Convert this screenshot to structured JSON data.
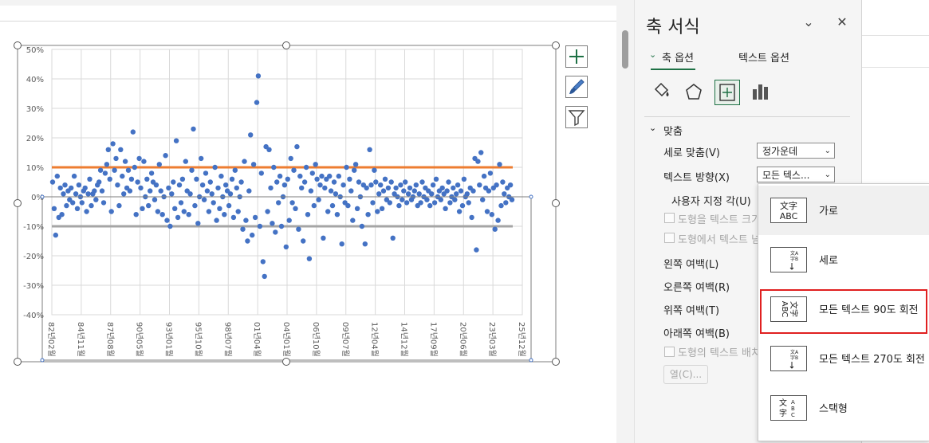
{
  "pane": {
    "title": "축 서식",
    "tab_axis_options": "축 옵션",
    "tab_text_options": "텍스트 옵션",
    "section_title": "맞춤",
    "vertical_align_label": "세로 맞춤(V)",
    "vertical_align_value": "정가운데",
    "text_direction_label": "텍스트 방향(X)",
    "text_direction_value": "모든 텍스...",
    "custom_angle_label": "사용자 지정 각(U)",
    "resize_shape_label": "도형을 텍스트 크기",
    "wrap_text_label": "도형에서 텍스트 넘",
    "left_margin_label": "왼쪽 여백(L)",
    "right_margin_label": "오른쪽 여백(R)",
    "top_margin_label": "위쪽 여백(T)",
    "bottom_margin_label": "아래쪽 여백(B)",
    "rotate_text_label": "도형의 텍스트 배치",
    "columns_button": "열(C)..."
  },
  "dropdown": {
    "options": [
      {
        "label": "가로",
        "icon": "horizontal-text-icon"
      },
      {
        "label": "세로",
        "icon": "vertical-text-icon"
      },
      {
        "label": "모든 텍스트 90도 회전",
        "icon": "rotate90-text-icon"
      },
      {
        "label": "모든 텍스트 270도 회전",
        "icon": "rotate270-text-icon"
      },
      {
        "label": "스택형",
        "icon": "stacked-text-icon"
      }
    ],
    "selected_index": 2
  },
  "chart_data": {
    "type": "scatter",
    "title": "",
    "xlabel": "",
    "ylabel": "",
    "ylim": [
      -0.4,
      0.5
    ],
    "y_ticks": [
      "50%",
      "40%",
      "30%",
      "20%",
      "10%",
      "0%",
      "-10%",
      "-20%",
      "-30%",
      "-40%"
    ],
    "x_ticks": [
      "82년02월",
      "84년11월",
      "87년08월",
      "90년05월",
      "93년01월",
      "95년10월",
      "98년07월",
      "01년04월",
      "04년01월",
      "06년10월",
      "09년07월",
      "12년04월",
      "14년12월",
      "17년09월",
      "20년06월",
      "23년03월",
      "25년12월"
    ],
    "lines": [
      {
        "value": 0.1,
        "color": "#ed7d31"
      },
      {
        "value": -0.1,
        "color": "#a5a5a5"
      }
    ],
    "series": [
      {
        "color": "#4472c4",
        "values": [
          0.05,
          -0.04,
          -0.13,
          0.07,
          -0.07,
          0.03,
          -0.06,
          0.01,
          0.04,
          -0.03,
          0.02,
          -0.01,
          0.03,
          -0.02,
          0.07,
          0.01,
          -0.04,
          0.04,
          0.0,
          -0.02,
          0.02,
          0.03,
          -0.05,
          0.01,
          0.06,
          -0.03,
          0.01,
          0.02,
          -0.01,
          0.04,
          0.05,
          0.09,
          0.02,
          -0.02,
          0.08,
          0.11,
          0.16,
          0.06,
          -0.05,
          0.18,
          0.09,
          0.13,
          0.04,
          -0.03,
          0.16,
          0.07,
          0.01,
          0.12,
          0.03,
          0.09,
          0.02,
          0.06,
          0.22,
          0.1,
          -0.06,
          0.05,
          0.13,
          0.03,
          -0.04,
          0.12,
          0.0,
          0.06,
          -0.03,
          0.02,
          0.08,
          0.05,
          -0.01,
          0.04,
          -0.05,
          0.11,
          0.02,
          -0.06,
          0.0,
          0.14,
          -0.08,
          0.03,
          -0.1,
          0.01,
          0.05,
          -0.04,
          0.19,
          -0.07,
          0.04,
          -0.02,
          0.06,
          -0.05,
          0.12,
          0.02,
          -0.06,
          0.01,
          0.09,
          0.23,
          -0.03,
          0.06,
          -0.09,
          0.0,
          0.13,
          0.04,
          -0.01,
          0.08,
          0.02,
          -0.05,
          0.05,
          0.01,
          -0.02,
          0.1,
          -0.08,
          0.03,
          -0.04,
          0.07,
          0.0,
          -0.06,
          0.04,
          0.02,
          -0.03,
          0.01,
          0.06,
          -0.07,
          0.09,
          0.03,
          -0.05,
          0.0,
          0.05,
          -0.11,
          0.12,
          -0.08,
          -0.15,
          0.02,
          0.21,
          -0.13,
          0.11,
          -0.07,
          0.32,
          0.41,
          -0.1,
          0.08,
          -0.22,
          -0.27,
          0.17,
          -0.05,
          0.16,
          0.03,
          -0.09,
          0.1,
          -0.12,
          0.05,
          -0.02,
          0.07,
          -0.1,
          0.0,
          0.04,
          -0.17,
          0.06,
          -0.08,
          0.13,
          -0.02,
          0.09,
          -0.04,
          0.17,
          -0.11,
          0.07,
          0.03,
          -0.15,
          0.05,
          0.1,
          -0.06,
          -0.21,
          0.02,
          0.08,
          -0.03,
          0.11,
          0.06,
          -0.01,
          0.04,
          0.07,
          -0.14,
          0.03,
          0.06,
          -0.05,
          0.07,
          0.02,
          -0.03,
          0.05,
          0.01,
          -0.06,
          0.07,
          0.0,
          -0.16,
          0.04,
          -0.02,
          0.1,
          -0.03,
          0.06,
          0.02,
          -0.08,
          0.09,
          0.11,
          -0.04,
          0.05,
          0.0,
          -0.1,
          0.04,
          -0.16,
          0.03,
          -0.06,
          0.16,
          0.04,
          -0.02,
          0.09,
          0.05,
          -0.05,
          0.01,
          0.04,
          -0.04,
          0.02,
          0.06,
          -0.01,
          0.03,
          -0.02,
          0.05,
          -0.14,
          0.01,
          0.03,
          0.0,
          -0.03,
          0.04,
          -0.01,
          0.02,
          0.05,
          -0.02,
          0.01,
          0.03,
          -0.01,
          0.0,
          0.02,
          0.04,
          -0.03,
          0.01,
          -0.02,
          0.05,
          0.0,
          0.03,
          -0.01,
          0.02,
          -0.03,
          0.01,
          0.04,
          -0.02,
          0.06,
          0.0,
          0.02,
          -0.01,
          0.03,
          0.01,
          -0.04,
          0.02,
          0.05,
          -0.02,
          0.0,
          0.03,
          -0.01,
          0.01,
          0.04,
          -0.05,
          0.02,
          -0.03,
          0.06,
          0.0,
          0.01,
          -0.02,
          0.03,
          -0.07,
          0.02,
          0.13,
          -0.18,
          0.12,
          0.04,
          0.15,
          -0.01,
          0.07,
          0.03,
          -0.05,
          0.02,
          0.08,
          -0.06,
          0.03,
          -0.11,
          0.04,
          -0.08,
          0.11,
          -0.03,
          0.05,
          0.01,
          -0.02,
          0.03,
          0.0,
          0.04,
          -0.01
        ]
      }
    ]
  }
}
